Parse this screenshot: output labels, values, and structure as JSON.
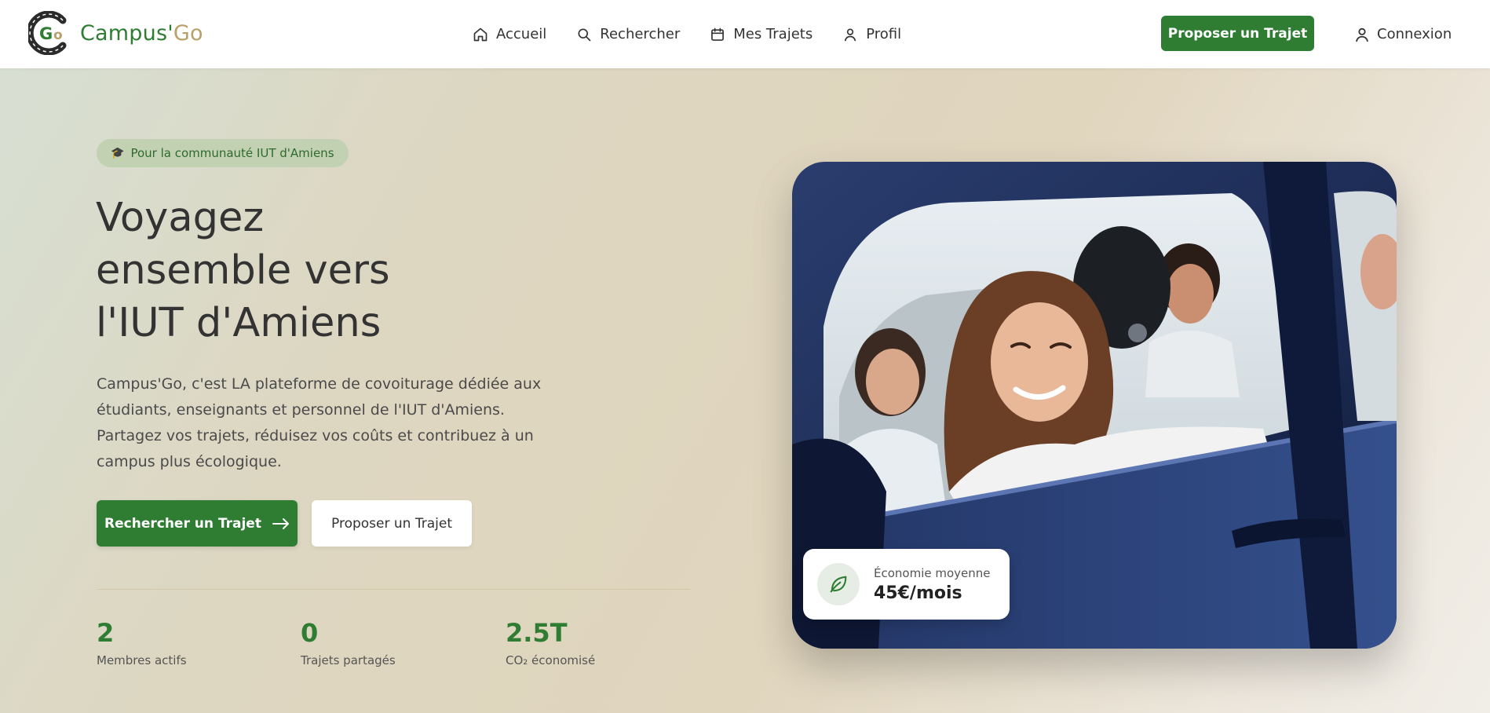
{
  "brand": {
    "part1": "Campus'",
    "part2": "Go",
    "colors": {
      "primary": "#2e7d32",
      "accent": "#b8a06a"
    }
  },
  "nav": {
    "items": [
      {
        "label": "Accueil",
        "icon": "home-icon"
      },
      {
        "label": "Rechercher",
        "icon": "search-icon"
      },
      {
        "label": "Mes Trajets",
        "icon": "calendar-icon"
      },
      {
        "label": "Profil",
        "icon": "user-icon"
      }
    ],
    "propose_label": "Proposer un Trajet",
    "login_label": "Connexion"
  },
  "hero": {
    "badge_icon": "graduation-cap-icon",
    "badge": "Pour la communauté IUT d'Amiens",
    "title_line1": "Voyagez",
    "title_line2": "ensemble vers",
    "title_line3": "l'IUT d'Amiens",
    "description": "Campus'Go, c'est LA plateforme de covoiturage dédiée aux étudiants, enseignants et personnel de l'IUT d'Amiens. Partagez vos trajets, réduisez vos coûts et contribuez à un campus plus écologique.",
    "search_button": "Rechercher un Trajet",
    "propose_button": "Proposer un Trajet"
  },
  "stats": [
    {
      "value": "2",
      "label": "Membres actifs"
    },
    {
      "value": "0",
      "label": "Trajets partagés"
    },
    {
      "value": "2.5T",
      "label": "CO₂ économisé"
    }
  ],
  "savings_card": {
    "icon": "leaf-icon",
    "label": "Économie moyenne",
    "value": "45€/mois"
  }
}
